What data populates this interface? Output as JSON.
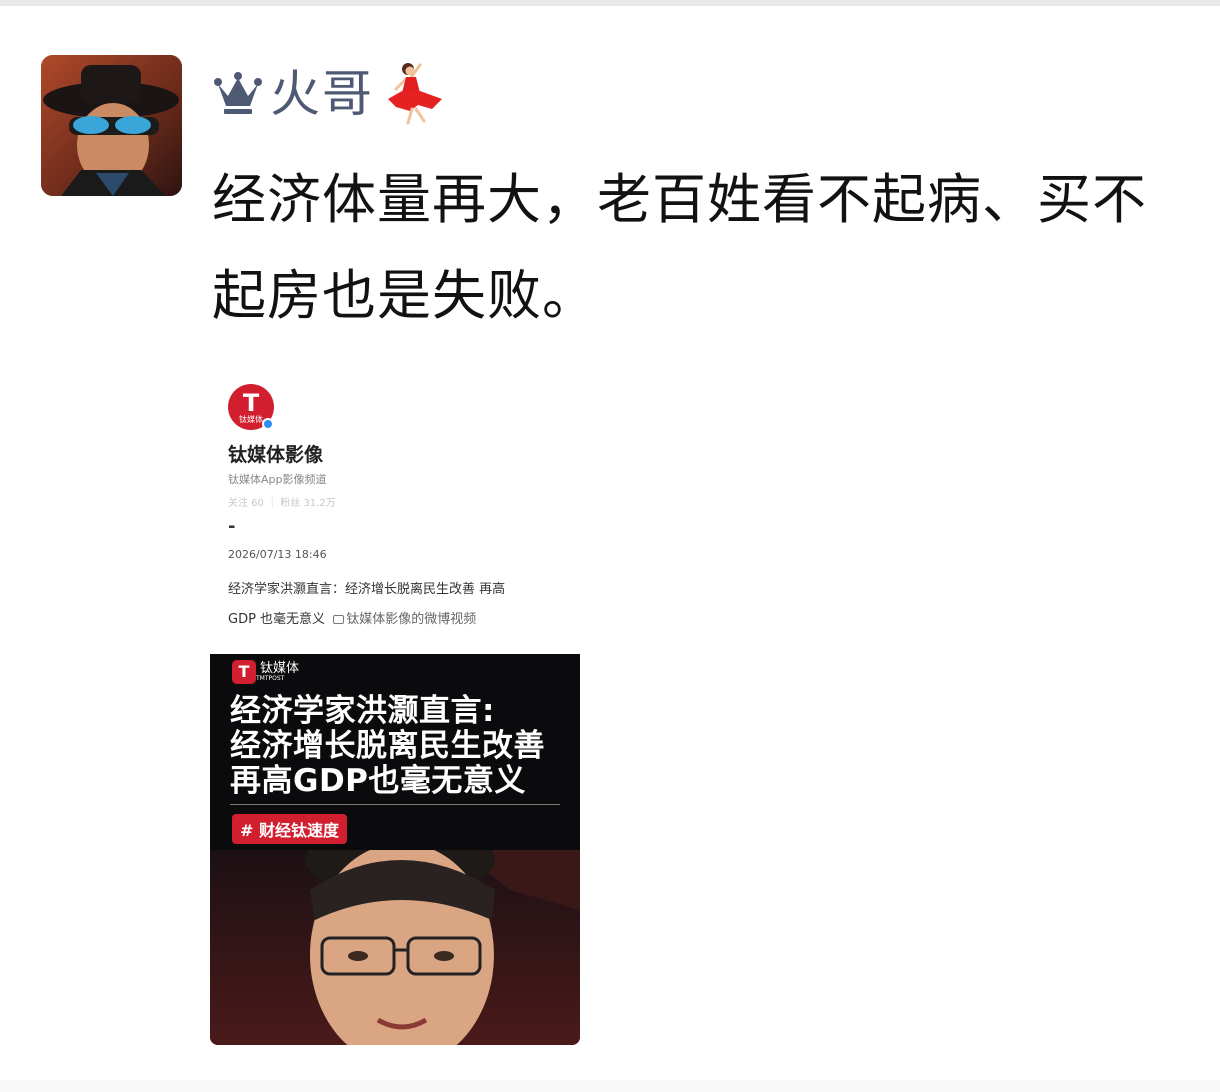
{
  "post": {
    "username": "火哥",
    "text": "经济体量再大，老百姓看不起病、买不起房也是失败。",
    "avatar_icon": "user-avatar-hat-sunglasses",
    "name_prefix_icon": "crown-icon",
    "name_suffix_icon": "dancer-emoji-icon"
  },
  "screenshot": {
    "logo_letter": "T",
    "logo_sub": "钛媒体",
    "account_name": "钛媒体影像",
    "account_desc": "钛媒体App影像频道",
    "account_stats": "关注 60 ｜ 粉丝 31.2万",
    "dash": "-",
    "date": "2026/07/13 18:46",
    "line1": "经济学家洪灏直言：经济增长脱离民生改善 再高",
    "line2_text": "GDP 也毫无意义",
    "line2_link": "钛媒体影像的微博视频"
  },
  "video": {
    "logo_letter": "T",
    "logo_text": "钛媒体",
    "logo_en": "TMTPOST",
    "headline_1": "经济学家洪灏直言:",
    "headline_2": "经济增长脱离民生改善",
    "headline_3": "再高GDP也毫无意义",
    "tag": "# 财经钛速度"
  },
  "colors": {
    "username": "#4e5a74",
    "brand_red": "#d11f2f",
    "thumb_bg": "#0b0b0d"
  }
}
